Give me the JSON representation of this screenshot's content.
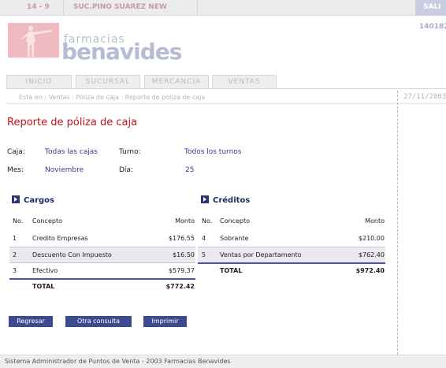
{
  "topbar": {
    "store_number": "14 - 9",
    "store_name": "SUC.PINO SUAREZ NEW",
    "exit_label": "SALI"
  },
  "header": {
    "logo_small": "farmacias",
    "logo_main": "benavides",
    "logo_reg": "®",
    "user_id": "140182"
  },
  "tabs": [
    "INICIO",
    "SUCURSAL",
    "MERCANCÍA",
    "VENTAS"
  ],
  "breadcrumb": "Está en : Ventas : Póliza de caja : Reporte de póliza de caja",
  "date": "27/11/2003",
  "page_title": "Reporte de póliza de caja",
  "filters": {
    "caja_label": "Caja:",
    "caja_value": "Todas las cajas",
    "turno_label": "Turno:",
    "turno_value": "Todos los turnos",
    "mes_label": "Mes:",
    "mes_value": "Noviembre",
    "dia_label": "Día:",
    "dia_value": "25"
  },
  "cargos": {
    "title": "Cargos",
    "col_no": "No.",
    "col_concepto": "Concepto",
    "col_monto": "Monto",
    "rows": [
      {
        "no": "1",
        "concepto": "Credito Empresas",
        "monto": "$176.55"
      },
      {
        "no": "2",
        "concepto": "Descuento Con Impuesto",
        "monto": "$16.50"
      },
      {
        "no": "3",
        "concepto": "Efectivo",
        "monto": "$579.37"
      }
    ],
    "total_label": "TOTAL",
    "total": "$772.42"
  },
  "creditos": {
    "title": "Créditos",
    "col_no": "No.",
    "col_concepto": "Concepto",
    "col_monto": "Monto",
    "rows": [
      {
        "no": "4",
        "concepto": "Sobrante",
        "monto": "$210.00"
      },
      {
        "no": "5",
        "concepto": "Ventas por Departamento",
        "monto": "$762.40"
      }
    ],
    "total_label": "TOTAL",
    "total": "$972.40"
  },
  "buttons": {
    "regresar": "Regresar",
    "otra_consulta": "Otra consulta",
    "imprimir": "Imprimir"
  },
  "footer": "Sistema Administrador de Puntos de Venta - 2003 Farmacias Benavides"
}
